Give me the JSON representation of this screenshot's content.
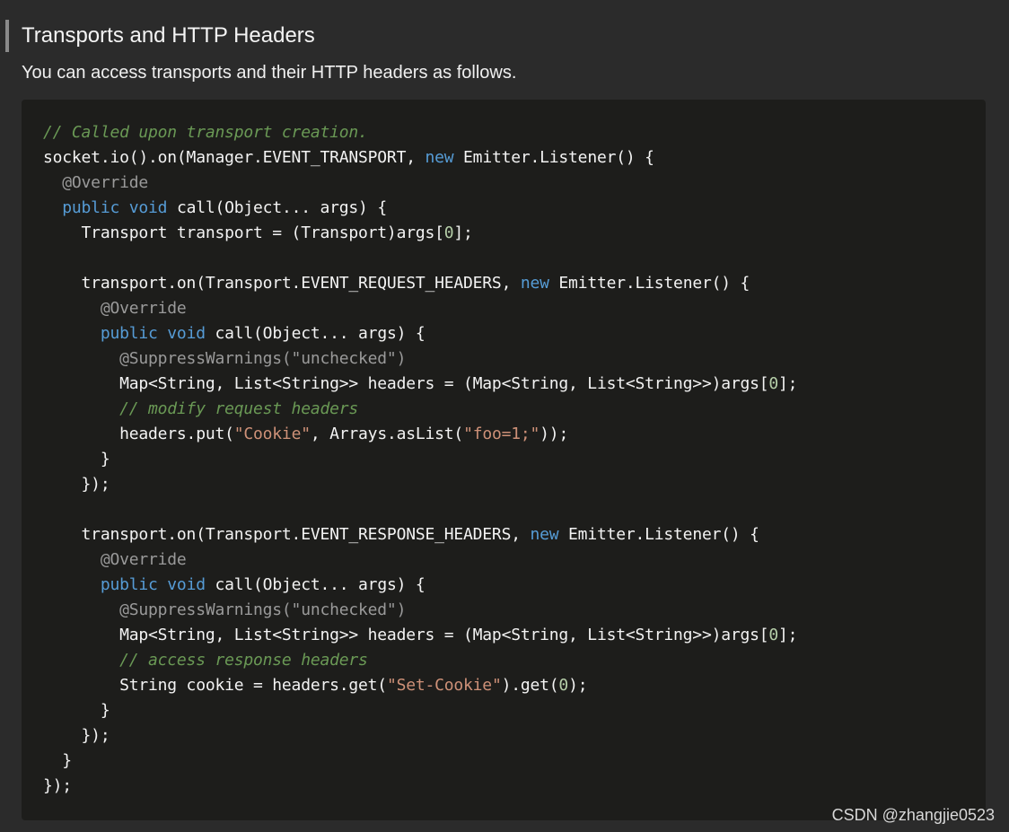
{
  "section": {
    "heading": "Transports and HTTP Headers",
    "intro": "You can access transports and their HTTP headers as follows."
  },
  "code": {
    "language": "java",
    "colors": {
      "comment": "#6a9955",
      "keyword": "#569cd6",
      "annotation": "#9a9a9a",
      "string": "#ce9178",
      "number": "#b5cea8",
      "plain": "#f3f3f3",
      "background": "#1d1d1b"
    },
    "lines": [
      [
        {
          "t": "comment",
          "v": "// Called upon transport creation."
        }
      ],
      [
        {
          "t": "plain",
          "v": "socket.io().on(Manager.EVENT_TRANSPORT, "
        },
        {
          "t": "keyword",
          "v": "new"
        },
        {
          "t": "plain",
          "v": " Emitter.Listener() {"
        }
      ],
      [
        {
          "t": "annotation",
          "v": "  @Override"
        }
      ],
      [
        {
          "t": "keyword",
          "v": "  public"
        },
        {
          "t": "plain",
          "v": " "
        },
        {
          "t": "keyword",
          "v": "void"
        },
        {
          "t": "plain",
          "v": " call(Object... args) {"
        }
      ],
      [
        {
          "t": "plain",
          "v": "    Transport transport = (Transport)args["
        },
        {
          "t": "number",
          "v": "0"
        },
        {
          "t": "plain",
          "v": "];"
        }
      ],
      [
        {
          "t": "plain",
          "v": ""
        }
      ],
      [
        {
          "t": "plain",
          "v": "    transport.on(Transport.EVENT_REQUEST_HEADERS, "
        },
        {
          "t": "keyword",
          "v": "new"
        },
        {
          "t": "plain",
          "v": " Emitter.Listener() {"
        }
      ],
      [
        {
          "t": "annotation",
          "v": "      @Override"
        }
      ],
      [
        {
          "t": "keyword",
          "v": "      public"
        },
        {
          "t": "plain",
          "v": " "
        },
        {
          "t": "keyword",
          "v": "void"
        },
        {
          "t": "plain",
          "v": " call(Object... args) {"
        }
      ],
      [
        {
          "t": "annotation",
          "v": "        @SuppressWarnings(\"unchecked\")"
        }
      ],
      [
        {
          "t": "plain",
          "v": "        Map<String, List<String>> headers = (Map<String, List<String>>)args["
        },
        {
          "t": "number",
          "v": "0"
        },
        {
          "t": "plain",
          "v": "];"
        }
      ],
      [
        {
          "t": "comment",
          "v": "        // modify request headers"
        }
      ],
      [
        {
          "t": "plain",
          "v": "        headers.put("
        },
        {
          "t": "string",
          "v": "\"Cookie\""
        },
        {
          "t": "plain",
          "v": ", Arrays.asList("
        },
        {
          "t": "string",
          "v": "\"foo=1;\""
        },
        {
          "t": "plain",
          "v": "));"
        }
      ],
      [
        {
          "t": "plain",
          "v": "      }"
        }
      ],
      [
        {
          "t": "plain",
          "v": "    });"
        }
      ],
      [
        {
          "t": "plain",
          "v": ""
        }
      ],
      [
        {
          "t": "plain",
          "v": "    transport.on(Transport.EVENT_RESPONSE_HEADERS, "
        },
        {
          "t": "keyword",
          "v": "new"
        },
        {
          "t": "plain",
          "v": " Emitter.Listener() {"
        }
      ],
      [
        {
          "t": "annotation",
          "v": "      @Override"
        }
      ],
      [
        {
          "t": "keyword",
          "v": "      public"
        },
        {
          "t": "plain",
          "v": " "
        },
        {
          "t": "keyword",
          "v": "void"
        },
        {
          "t": "plain",
          "v": " call(Object... args) {"
        }
      ],
      [
        {
          "t": "annotation",
          "v": "        @SuppressWarnings(\"unchecked\")"
        }
      ],
      [
        {
          "t": "plain",
          "v": "        Map<String, List<String>> headers = (Map<String, List<String>>)args["
        },
        {
          "t": "number",
          "v": "0"
        },
        {
          "t": "plain",
          "v": "];"
        }
      ],
      [
        {
          "t": "comment",
          "v": "        // access response headers"
        }
      ],
      [
        {
          "t": "plain",
          "v": "        String cookie = headers.get("
        },
        {
          "t": "string",
          "v": "\"Set-Cookie\""
        },
        {
          "t": "plain",
          "v": ").get("
        },
        {
          "t": "number",
          "v": "0"
        },
        {
          "t": "plain",
          "v": ");"
        }
      ],
      [
        {
          "t": "plain",
          "v": "      }"
        }
      ],
      [
        {
          "t": "plain",
          "v": "    });"
        }
      ],
      [
        {
          "t": "plain",
          "v": "  }"
        }
      ],
      [
        {
          "t": "plain",
          "v": "});"
        }
      ]
    ]
  },
  "watermark": "CSDN @zhangjie0523"
}
